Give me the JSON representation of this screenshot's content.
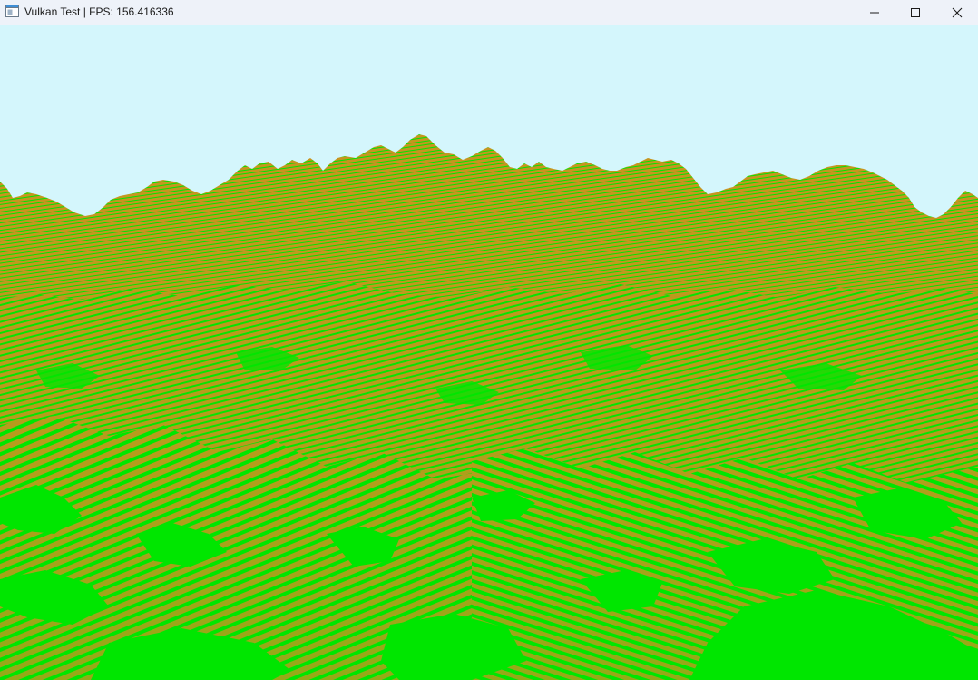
{
  "window": {
    "title": "Vulkan Test | FPS: 156.416336",
    "app_icon": "app-window-icon",
    "controls": {
      "minimize_icon": "minimize-icon",
      "maximize_icon": "maximize-icon",
      "close_icon": "close-icon"
    }
  },
  "scene": {
    "sky_color": "#d4f6fc",
    "terrain_color": "#c7951f",
    "grass_color": "#00e600"
  }
}
